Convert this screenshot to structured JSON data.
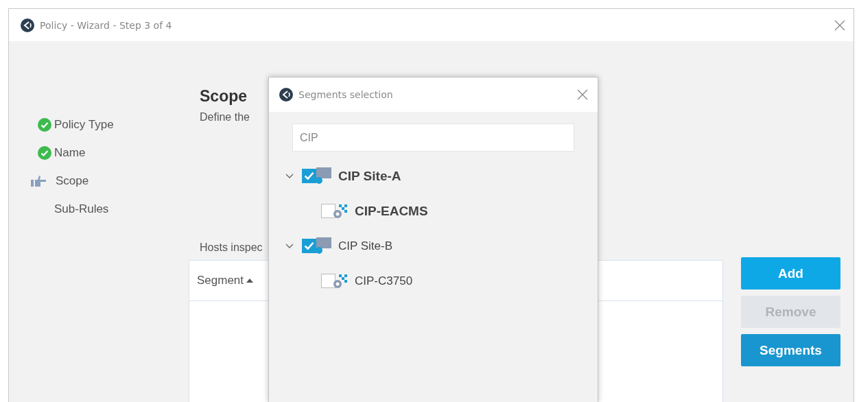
{
  "window": {
    "title": "Policy - Wizard - Step 3 of 4"
  },
  "steps": [
    {
      "label": "Policy Type",
      "completed": true,
      "current": false
    },
    {
      "label": "Name",
      "completed": true,
      "current": false
    },
    {
      "label": "Scope",
      "completed": false,
      "current": true
    },
    {
      "label": "Sub-Rules",
      "completed": false,
      "current": false
    }
  ],
  "section": {
    "title": "Scope",
    "description": "Define the",
    "hosts_label": "Hosts inspec"
  },
  "table": {
    "columns": [
      {
        "label": "Segment",
        "sort_ascending": true
      }
    ]
  },
  "buttons": [
    {
      "label": "Add",
      "kind": "primary",
      "disabled": false
    },
    {
      "label": "Remove",
      "kind": "primary",
      "disabled": true
    },
    {
      "label": "Segments",
      "kind": "secondary",
      "disabled": false
    }
  ],
  "dialog": {
    "title": "Segments selection",
    "search": {
      "value": "CIP"
    },
    "tree": [
      {
        "label": "CIP Site-A",
        "kind": "site",
        "checked": true,
        "expanded": true,
        "highlighted": true,
        "children": [
          {
            "label": "CIP-EACMS",
            "kind": "segment",
            "checked": false,
            "highlighted": true
          }
        ]
      },
      {
        "label": "CIP Site-B",
        "kind": "site",
        "checked": true,
        "expanded": true,
        "highlighted": false,
        "children": [
          {
            "label": "CIP-C3750",
            "kind": "segment",
            "checked": false,
            "highlighted": false
          }
        ]
      }
    ]
  }
}
